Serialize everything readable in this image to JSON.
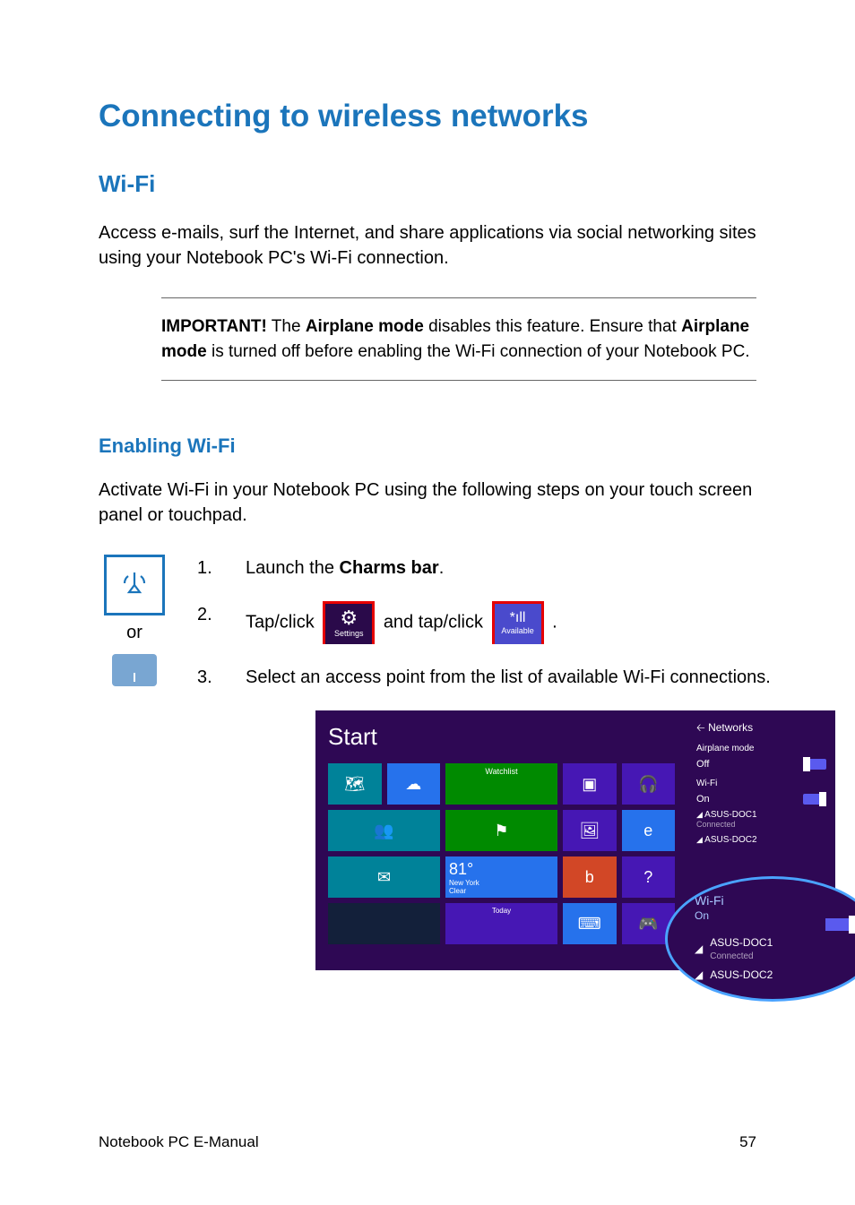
{
  "title": "Connecting to wireless networks",
  "section": "Wi-Fi",
  "intro": "Access e-mails, surf the Internet, and share applications via social networking sites using your Notebook PC's Wi-Fi connection.",
  "important": {
    "label": "IMPORTANT!",
    "text_a": " The ",
    "bold_a": "Airplane mode",
    "text_b": " disables this feature. Ensure that ",
    "bold_b": "Airplane mode",
    "text_c": " is turned off before enabling the Wi-Fi connection of your Notebook PC."
  },
  "subsection": "Enabling Wi-Fi",
  "subintro": "Activate Wi-Fi in your Notebook PC using the following steps on your touch screen panel or touchpad.",
  "or_label": "or",
  "steps": {
    "s1_a": "Launch the ",
    "s1_b": "Charms bar",
    "s1_c": ".",
    "s2_a": "Tap/click ",
    "s2_b": " and tap/click ",
    "s2_c": ".",
    "s3": "Select an access point from the list of available Wi-Fi connections."
  },
  "icons": {
    "settings_label": "Settings",
    "available_label": "Available"
  },
  "screenshot": {
    "start_label": "Start",
    "weather_temp": "81°",
    "weather_city": "New York",
    "weather_cond": "Clear",
    "networks_header": "Networks",
    "airplane_label": "Airplane mode",
    "airplane_state": "Off",
    "wifi_label": "Wi-Fi",
    "wifi_state": "On",
    "ap1_name": "ASUS-DOC1",
    "ap1_status": "Connected",
    "ap2_name": "ASUS-DOC2"
  },
  "zoom": {
    "wifi_label": "Wi-Fi",
    "wifi_state": "On",
    "ap1_name": "ASUS-DOC1",
    "ap1_status": "Connected",
    "ap2_name": "ASUS-DOC2"
  },
  "footer": {
    "left": "Notebook PC E-Manual",
    "right": "57"
  }
}
